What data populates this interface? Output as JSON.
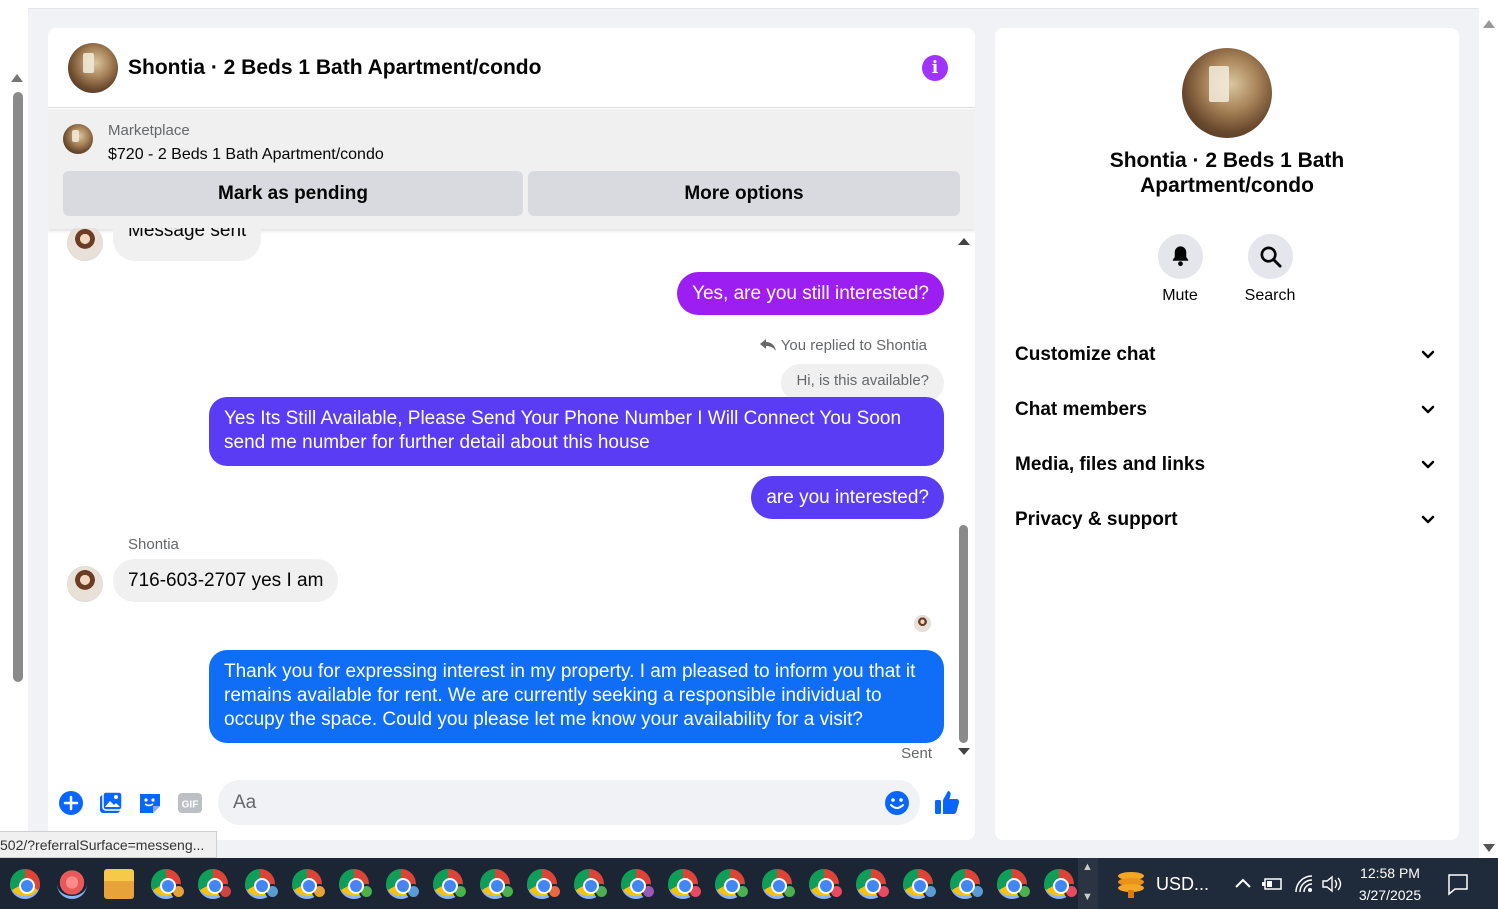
{
  "chat": {
    "title": "Shontia · 2 Beds 1 Bath Apartment/condo",
    "info_icon": "i",
    "marketplace": {
      "label": "Marketplace",
      "listing": "$720 - 2 Beds 1 Bath Apartment/condo",
      "mark_pending": "Mark as pending",
      "more_options": "More options"
    },
    "messages": {
      "m0": "Message sent",
      "m1": "Yes, are you still interested?",
      "reply_note": "You replied to Shontia",
      "quoted": "Hi, is this available?",
      "m2_line1": "Yes Its Still Available, Please Send Your Phone Number I Will Connect You Soon",
      "m2_line2": "send me number for further detail about this house",
      "m3": "are you interested?",
      "sender": "Shontia",
      "m4": "716-603-2707 yes I am",
      "m5_line1": "Thank you for expressing interest in my property. I am pleased to inform you that it",
      "m5_line2": "remains available for rent. We are currently seeking a responsible individual to",
      "m5_line3": "occupy the space. Could you please let me know your availability for a visit?",
      "status": "Sent"
    },
    "composer": {
      "placeholder": "Aa"
    }
  },
  "sidebar": {
    "name_line1": "Shontia · 2 Beds 1 Bath",
    "name_line2": "Apartment/condo",
    "mute": "Mute",
    "search": "Search",
    "sections": [
      "Customize chat",
      "Chat members",
      "Media, files and links",
      "Privacy & support"
    ]
  },
  "status_url": "502/?referralSurface=messeng...",
  "taskbar": {
    "currency": "USD...",
    "time": "12:58 PM",
    "date": "3/27/2025",
    "badge_colors": [
      "#e8a23a",
      "#c44",
      "#5b9bd5",
      "#e8a23a",
      "#4caf50",
      "#5b9bd5",
      "#4caf50",
      "#4caf50",
      "#e86a3a",
      "#4caf50",
      "#9b59b6",
      "#e84a5f",
      "#4caf50",
      "#4caf50",
      "#e84a5f",
      "#e84a5f",
      "#5b9bd5",
      "#5b9bd5",
      "#4caf50",
      "#e84a5f"
    ]
  },
  "colors": {
    "accent_purple": "#a033ff",
    "bubble_blue": "#0f6ef5",
    "messenger_blue": "#0866ff"
  }
}
